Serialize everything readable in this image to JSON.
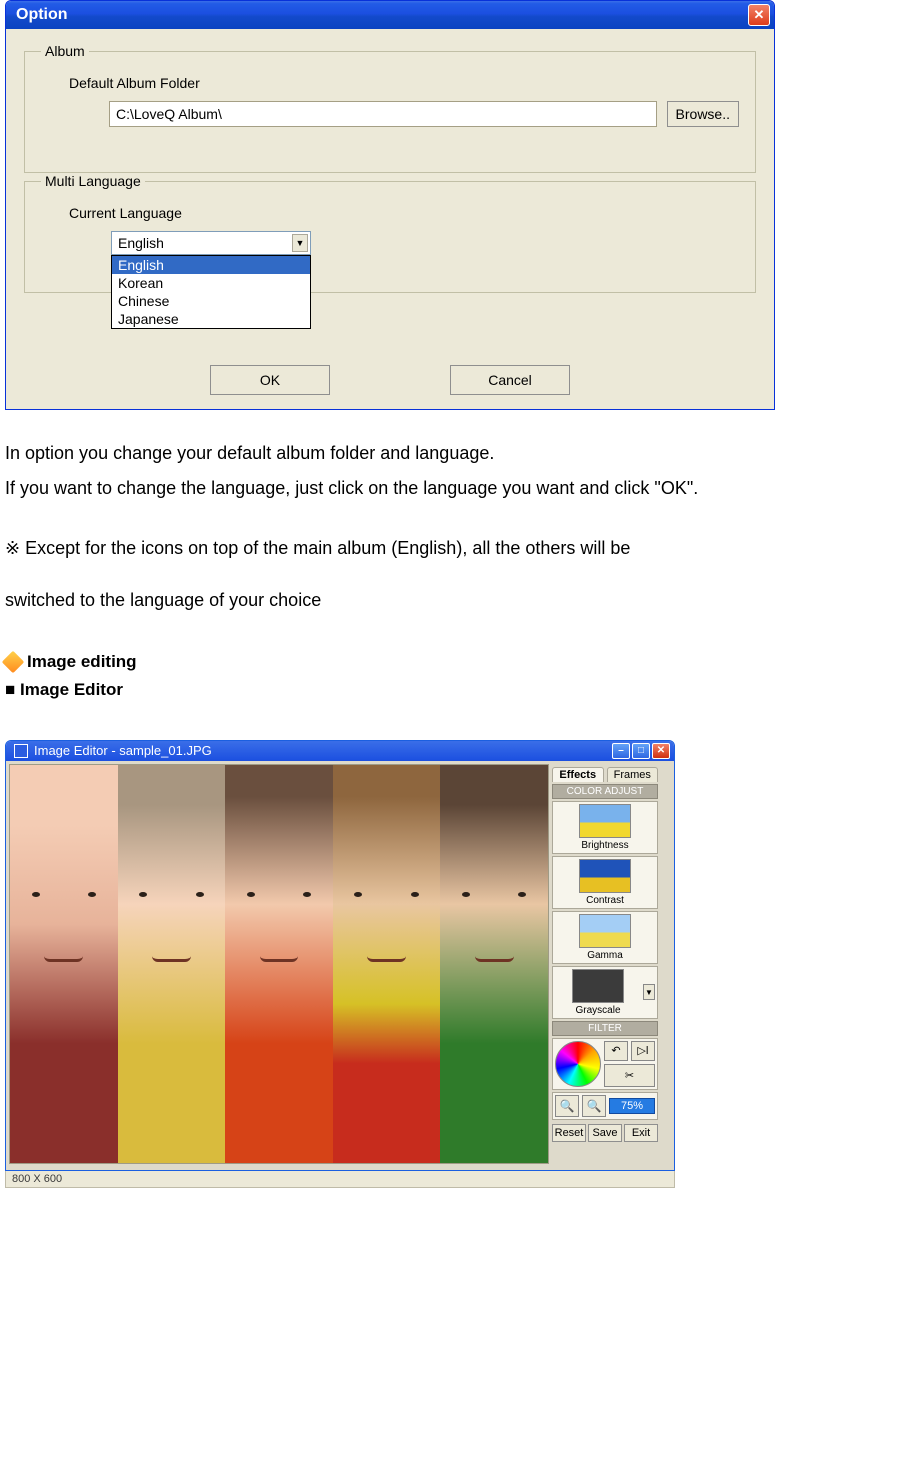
{
  "option": {
    "title": "Option",
    "album": {
      "legend": "Album",
      "label": "Default Album Folder",
      "path": "C:\\LoveQ Album\\",
      "browse": "Browse.."
    },
    "multilang": {
      "legend": "Multi Language",
      "label": "Current Language",
      "value": "English",
      "options": [
        "English",
        "Korean",
        "Chinese",
        "Japanese"
      ]
    },
    "ok": "OK",
    "cancel": "Cancel"
  },
  "text": {
    "p1": "In option you change your default album folder and language.",
    "p2": "If you want to change the language, just click on the language you want and click \"OK\".",
    "note": "※ Except for the icons on top of the main album (English), all the others will be",
    "note2": "switched to the language of your choice"
  },
  "section": {
    "head": "Image editing",
    "sub": "■ Image Editor"
  },
  "editor": {
    "title": "Image Editor - sample_01.JPG",
    "tabs": [
      "Effects",
      "Frames"
    ],
    "panel1": "COLOR ADJUST",
    "items": [
      "Brightness",
      "Contrast",
      "Gamma",
      "Grayscale"
    ],
    "panel2": "FILTER",
    "zoom": "75%",
    "buttons": [
      "Reset",
      "Save",
      "Exit"
    ],
    "status": "800 X 600"
  }
}
